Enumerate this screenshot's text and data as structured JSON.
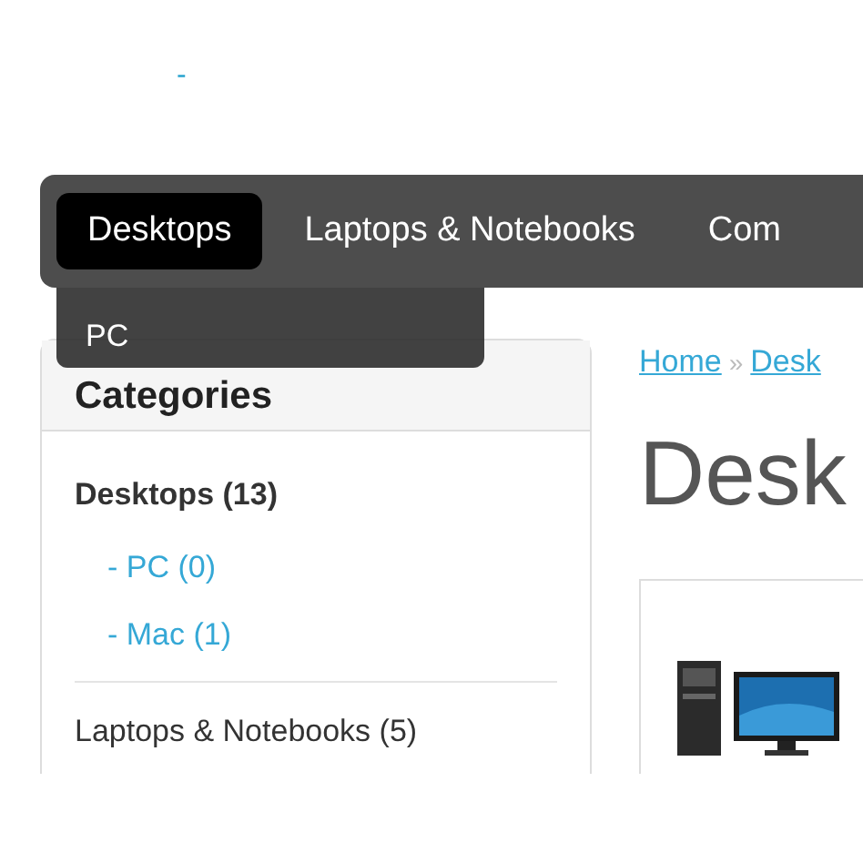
{
  "header": {
    "link": "-"
  },
  "nav": {
    "items": [
      {
        "label": "Desktops",
        "selected": true
      },
      {
        "label": "Laptops & Notebooks",
        "selected": false
      },
      {
        "label": "Com",
        "selected": false
      }
    ],
    "dropdown": {
      "items": [
        "PC"
      ]
    }
  },
  "sidebar": {
    "title": "Categories",
    "items": [
      {
        "label": "Desktops (13)",
        "selected": true,
        "children": [
          {
            "label": "- PC (0)"
          },
          {
            "label": "- Mac (1)"
          }
        ]
      },
      {
        "label": "Laptops & Notebooks (5)",
        "selected": false
      }
    ]
  },
  "breadcrumb": {
    "separator": "»",
    "items": [
      "Home",
      "Desk"
    ]
  },
  "heading": "Desk"
}
